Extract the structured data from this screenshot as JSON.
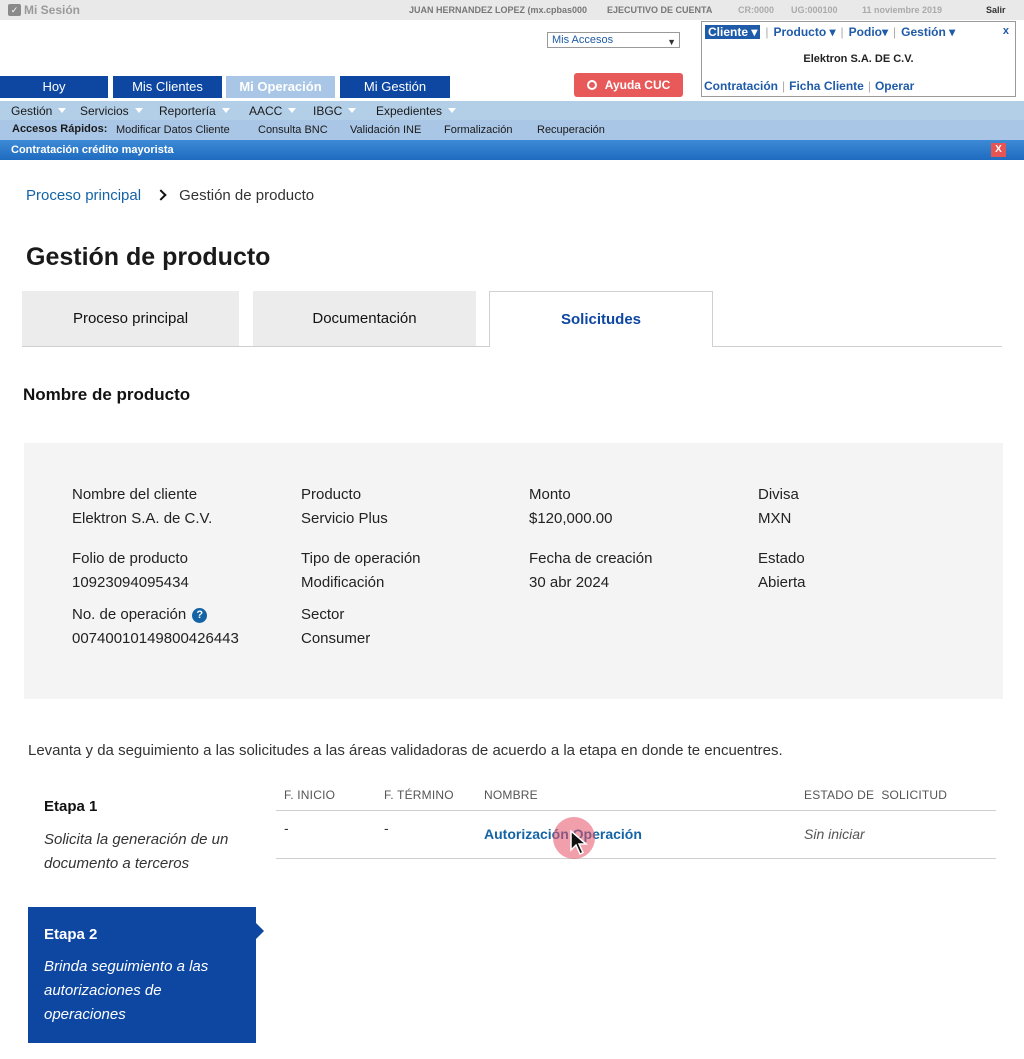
{
  "session": {
    "title": "Mi Sesión",
    "user": "JUAN HERNANDEZ LOPEZ (mx.cpbas000",
    "role": "EJECUTIVO DE CUENTA",
    "cr": "CR:0000",
    "ug": "UG:000100",
    "date": "11 noviembre 2019",
    "logout": "Salir"
  },
  "accesos_select": {
    "value": "Mis Accesos"
  },
  "main_tabs": [
    "Hoy",
    "Mis Clientes",
    "Mi Operación",
    "Mi Gestión"
  ],
  "main_tab_active": "Mi Operación",
  "help_button": "Ayuda CUC",
  "client_box": {
    "menus": [
      "Cliente",
      "Producto",
      "Podio",
      "Gestión"
    ],
    "close": "x",
    "client_name": "Elektron S.A. DE C.V.",
    "links": [
      "Contratación",
      "Ficha Cliente",
      "Operar"
    ]
  },
  "menu_bar": [
    "Gestión",
    "Servicios",
    "Reportería",
    "AACC",
    "IBGC",
    "Expedientes"
  ],
  "quick_access": {
    "label": "Accesos Rápidos:",
    "links": [
      "Modificar Datos Cliente",
      "Consulta BNC",
      "Validación INE",
      "Formalización",
      "Recuperación"
    ]
  },
  "context_bar": {
    "title": "Contratación crédito mayorista",
    "close": "X"
  },
  "breadcrumb": {
    "home": "Proceso principal",
    "current": "Gestión de producto"
  },
  "page_title": "Gestión de producto",
  "tabs": [
    "Proceso principal",
    "Documentación",
    "Solicitudes"
  ],
  "active_tab": "Solicitudes",
  "section_title": "Nombre de producto",
  "info": {
    "cliente_label": "Nombre del cliente",
    "cliente_value": "Elektron S.A. de C.V.",
    "producto_label": "Producto",
    "producto_value": "Servicio Plus",
    "monto_label": "Monto",
    "monto_value": "$120,000.00",
    "divisa_label": "Divisa",
    "divisa_value": "MXN",
    "folio_label": "Folio de producto",
    "folio_value": "10923094095434",
    "tipo_label": "Tipo de operación",
    "tipo_value": "Modificación",
    "fecha_label": "Fecha de creación",
    "fecha_value": "30 abr 2024",
    "estado_label": "Estado",
    "estado_value": "Abierta",
    "operacion_label": "No. de operación",
    "operacion_value": "00740010149800426443",
    "sector_label": "Sector",
    "sector_value": "Consumer",
    "help_glyph": "?"
  },
  "description": "Levanta y da seguimiento a las solicitudes a las áreas validadoras de acuerdo a la etapa en donde te encuentres.",
  "stages": [
    {
      "title": "Etapa 1",
      "description": "Solicita la generación de un documento a terceros"
    },
    {
      "title": "Etapa 2",
      "description": "Brinda seguimiento a las autorizaciones de operaciones"
    }
  ],
  "table": {
    "headers": [
      "F. INICIO",
      "F. TÉRMINO",
      "NOMBRE",
      "ESTADO DE  SOLICITUD"
    ],
    "rows": [
      {
        "inicio": "-",
        "termino": "-",
        "nombre": "Autorización Operación",
        "estado": "Sin iniciar"
      }
    ]
  }
}
